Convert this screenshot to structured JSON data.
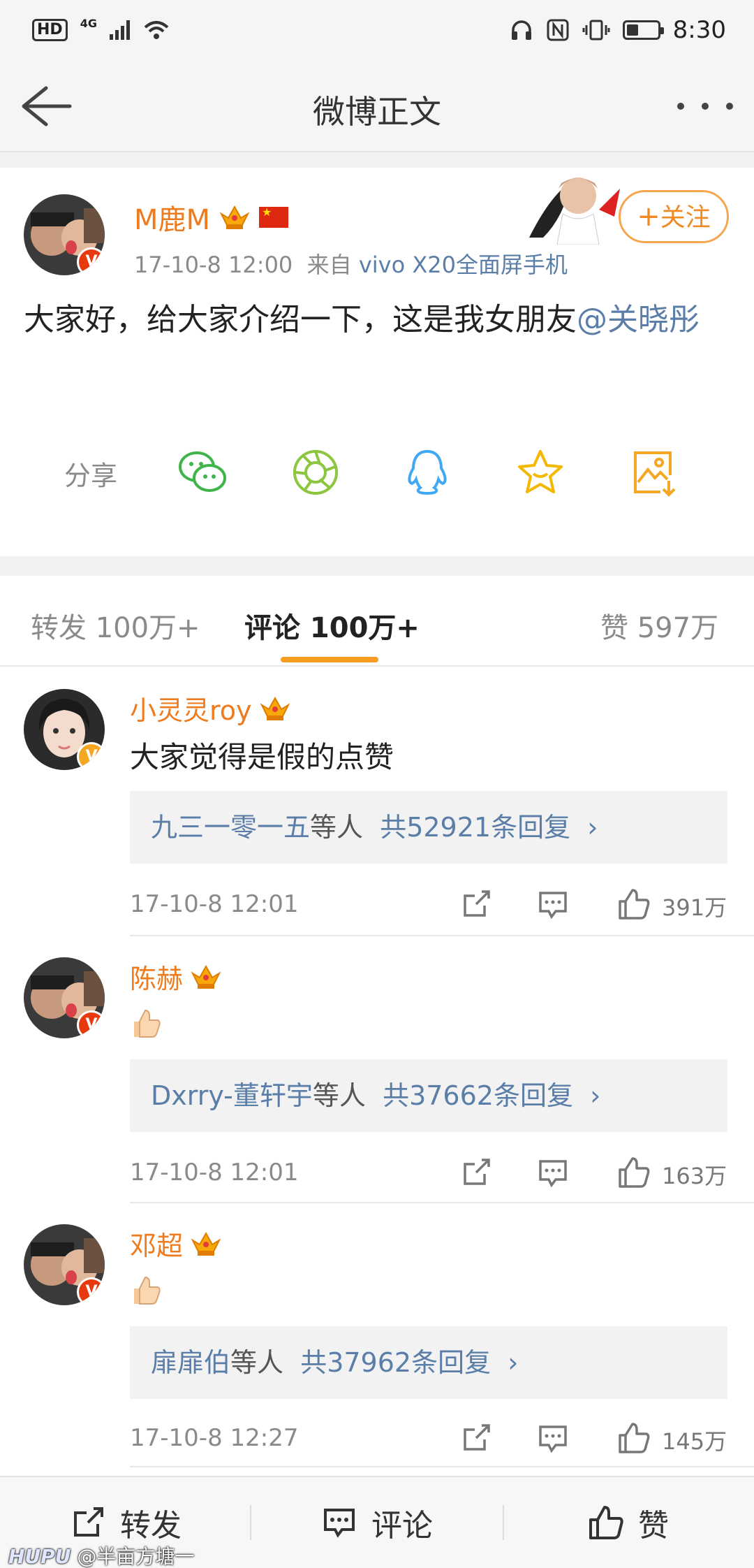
{
  "status_bar": {
    "hd": "HD",
    "network": "4G",
    "time": "8:30"
  },
  "nav": {
    "title": "微博正文"
  },
  "post": {
    "author": "M鹿M",
    "time": "17-10-8 12:00",
    "source_prefix": "来自",
    "source": "vivo X20全面屏手机",
    "follow_label": "关注",
    "text_main": "大家好，给大家介绍一下，这是我女朋友",
    "mention": "@关晓彤",
    "share_label": "分享",
    "share_icons": [
      "wechat-icon",
      "moments-icon",
      "qq-icon",
      "favorite-icon",
      "save-image-icon"
    ]
  },
  "tabs": {
    "repost": "转发 100万+",
    "comment": "评论 100万+",
    "like": "赞 597万"
  },
  "comments": [
    {
      "name": "小灵灵roy",
      "text": "大家觉得是假的点赞",
      "reply_names": "九三一零一五",
      "reply_suffix": "等人",
      "reply_count": "共52921条回复",
      "time": "17-10-8 12:01",
      "likes": "391万"
    },
    {
      "name": "陈赫",
      "text": "",
      "reply_names": "Dxrry-董轩宇",
      "reply_suffix": "等人",
      "reply_count": "共37662条回复",
      "time": "17-10-8 12:01",
      "likes": "163万"
    },
    {
      "name": "邓超",
      "text": "",
      "reply_names": "扉扉伯",
      "reply_suffix": "等人",
      "reply_count": "共37962条回复",
      "time": "17-10-8 12:27",
      "likes": "145万"
    }
  ],
  "bottom_bar": {
    "repost": "转发",
    "comment": "评论",
    "like": "赞"
  },
  "watermark": {
    "site": "HUPU",
    "user": "@半亩方塘一"
  },
  "colors": {
    "accent_orange": "#ee7c1f",
    "link_blue": "#5a7ea8",
    "tab_underline": "#f79d21"
  }
}
